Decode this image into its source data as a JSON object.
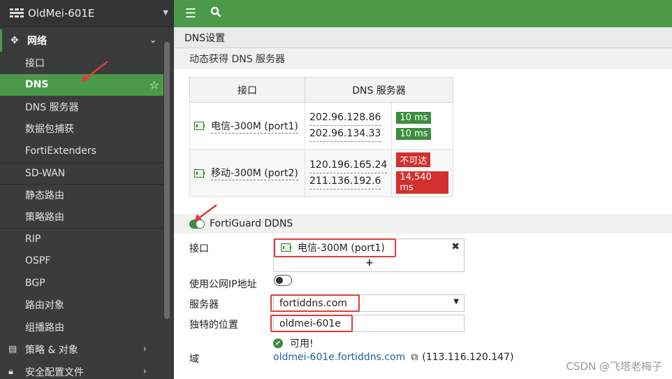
{
  "device": {
    "name": "OldMei-601E"
  },
  "colors": {
    "accent": "#4a9a4a",
    "sidebar_bg": "#3b3b3b",
    "ok": "#3c8d40",
    "error": "#d32f2f",
    "highlight": "#e03c3c"
  },
  "sidebar": {
    "section": "网络",
    "items": [
      {
        "label": "接口"
      },
      {
        "label": "DNS"
      },
      {
        "label": "DNS 服务器"
      },
      {
        "label": "数据包捕获"
      },
      {
        "label": "FortiExtenders"
      },
      {
        "label": "SD-WAN"
      },
      {
        "label": "静态路由"
      },
      {
        "label": "策略路由"
      },
      {
        "label": "RIP"
      },
      {
        "label": "OSPF"
      },
      {
        "label": "BGP"
      },
      {
        "label": "路由对象"
      },
      {
        "label": "组播路由"
      }
    ],
    "bottom": [
      {
        "label": "策略 & 对象"
      },
      {
        "label": "安全配置文件"
      }
    ]
  },
  "page": {
    "title": "DNS设置"
  },
  "dynamic_dns": {
    "title": "动态获得 DNS 服务器",
    "columns": [
      "接口",
      "DNS 服务器"
    ],
    "rows": [
      {
        "interface": "电信-300M (port1)",
        "servers": [
          "202.96.128.86",
          "202.96.134.33"
        ],
        "latency": [
          "10 ms",
          "10 ms"
        ]
      },
      {
        "interface": "移动-300M (port2)",
        "servers": [
          "120.196.165.24",
          "211.136.192.6"
        ],
        "latency": [
          "不可达",
          "14,540 ms"
        ]
      }
    ]
  },
  "ddns": {
    "title": "FortiGuard DDNS",
    "interface_label": "接口",
    "interface_value": "电信-300M (port1)",
    "public_ip_label": "使用公网IP地址",
    "server_label": "服务器",
    "server_value": "fortiddns.com",
    "unique_label": "独特的位置",
    "unique_value": "oldmei-601e",
    "status_text": "可用!",
    "domain_label": "域",
    "domain_value": "oldmei-601e.fortiddns.com",
    "domain_ip": "(113.116.120.147)"
  },
  "watermark": "CSDN @飞塔老梅子"
}
